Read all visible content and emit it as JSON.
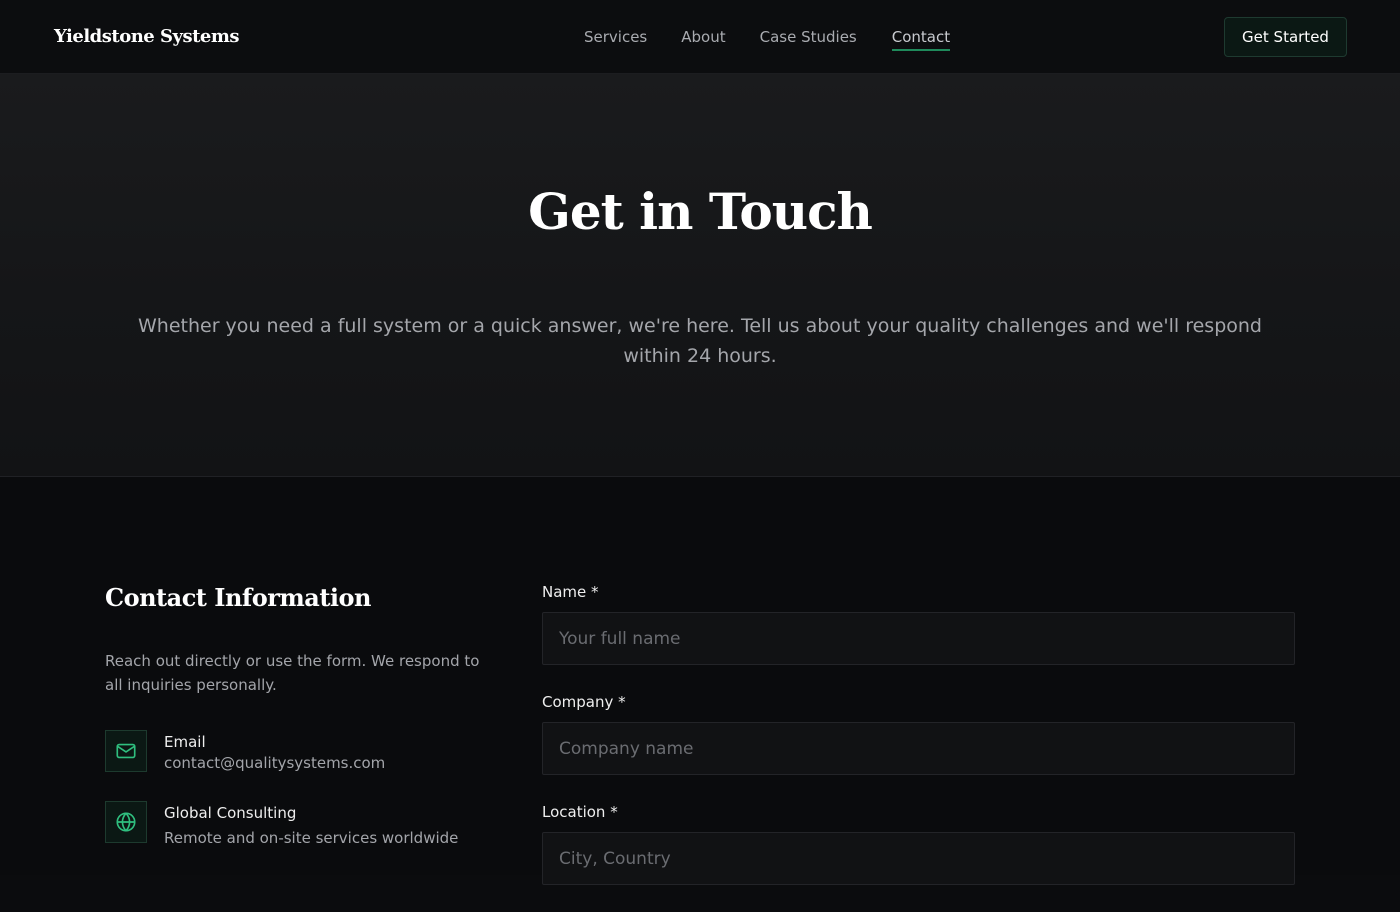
{
  "nav": {
    "brand": "Yieldstone Systems",
    "links": [
      {
        "label": "Services"
      },
      {
        "label": "About"
      },
      {
        "label": "Case Studies"
      },
      {
        "label": "Contact",
        "active": true
      }
    ],
    "cta_label": "Get Started"
  },
  "hero": {
    "title": "Get in Touch",
    "subtitle": "Whether you need a full system or a quick answer, we're here. Tell us about your quality challenges and we'll respond within 24 hours."
  },
  "contact_info": {
    "title": "Contact Information",
    "description": "Reach out directly or use the form. We respond to all inquiries personally.",
    "items": [
      {
        "icon": "mail-icon",
        "label": "Email",
        "value": "contact@qualitysystems.com"
      },
      {
        "icon": "globe-icon",
        "label": "Global Consulting",
        "value": "Remote and on-site services worldwide"
      }
    ]
  },
  "form": {
    "fields": [
      {
        "label": "Name *",
        "placeholder": "Your full name",
        "value": ""
      },
      {
        "label": "Company *",
        "placeholder": "Company name",
        "value": ""
      },
      {
        "label": "Location *",
        "placeholder": "City, Country",
        "value": ""
      }
    ]
  },
  "colors": {
    "accent": "#1f8a5b",
    "icon_stroke": "#2fbf7f",
    "background": "#0b0c0e"
  }
}
